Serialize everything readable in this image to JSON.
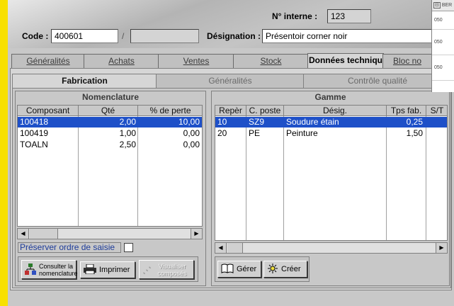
{
  "header": {
    "code_label": "Code :",
    "code_value": "400601",
    "slash": "/",
    "designation_label": "Désignation :",
    "designation_value": "Présentoir corner noir",
    "internal_label": "N° interne :",
    "internal_value": "123"
  },
  "tabs": [
    "Généralités",
    "Achats",
    "Ventes",
    "Stock",
    "Données techniqu",
    "Bloc no"
  ],
  "subtabs": [
    "Fabrication",
    "Généralités",
    "Contrôle qualité"
  ],
  "nomenclature": {
    "title": "Nomenclature",
    "columns": [
      "Composant",
      "Qté",
      "% de perte"
    ],
    "rows": [
      [
        "100418",
        "2,00",
        "10,00"
      ],
      [
        "100419",
        "1,00",
        "0,00"
      ],
      [
        "TOALN",
        "2,50",
        "0,00"
      ]
    ],
    "preserve_label": "Préserver ordre de saisie",
    "btn_consult": "Consulter la nomenclature",
    "btn_print": "Imprimer",
    "btn_visualize": "Visualiser composés"
  },
  "gamme": {
    "title": "Gamme",
    "columns": [
      "Repèr",
      "C. poste",
      "Désig.",
      "Tps fab.",
      "S/T"
    ],
    "rows": [
      [
        "10",
        "SZ9",
        "Soudure étain",
        "0,25",
        ""
      ],
      [
        "20",
        "PE",
        "Peinture",
        "1,50",
        ""
      ]
    ],
    "btn_manage": "Gérer",
    "btn_create": "Créer"
  },
  "side_popup": {
    "header": "BER",
    "items": [
      "050",
      "050",
      "050"
    ]
  },
  "colors": {
    "selection": "#1e50c8",
    "background": "#f8e000"
  }
}
